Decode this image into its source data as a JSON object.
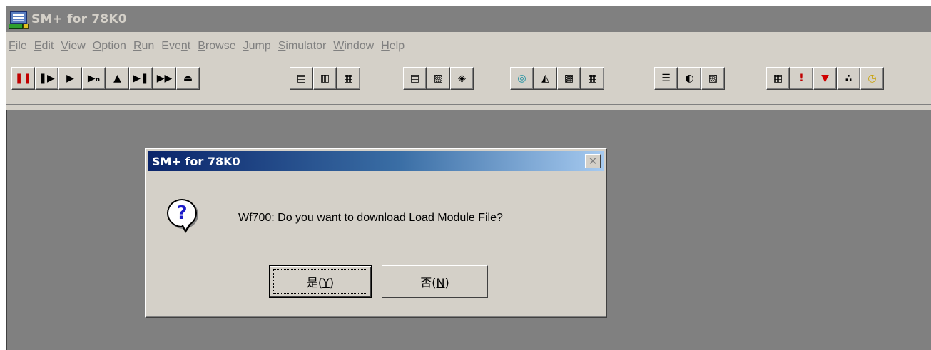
{
  "window": {
    "title": "SM+ for 78K0"
  },
  "menu": [
    {
      "label": "File",
      "mnemonic": "F",
      "rest": "ile"
    },
    {
      "label": "Edit",
      "mnemonic": "E",
      "rest": "dit"
    },
    {
      "label": "View",
      "mnemonic": "V",
      "rest": "iew"
    },
    {
      "label": "Option",
      "mnemonic": "O",
      "rest": "ption"
    },
    {
      "label": "Run",
      "mnemonic": "R",
      "rest": "un"
    },
    {
      "label": "Event",
      "prefix": "Eve",
      "mnemonic": "n",
      "rest": "t"
    },
    {
      "label": "Browse",
      "mnemonic": "B",
      "rest": "rowse"
    },
    {
      "label": "Jump",
      "mnemonic": "J",
      "rest": "ump"
    },
    {
      "label": "Simulator",
      "mnemonic": "S",
      "rest": "imulator"
    },
    {
      "label": "Window",
      "mnemonic": "W",
      "rest": "indow"
    },
    {
      "label": "Help",
      "mnemonic": "H",
      "rest": "elp"
    }
  ],
  "toolbar": {
    "groups": [
      [
        "pause-icon",
        "step-execute-icon",
        "run-icon",
        "next-over-icon",
        "return-icon",
        "step-in-icon",
        "go-icon",
        "eject-icon"
      ],
      [
        "source-text-icon",
        "assemble-icon",
        "memory-icon"
      ],
      [
        "register-icon",
        "sfr-icon",
        "local-variable-icon"
      ],
      [
        "watch-icon",
        "trace-icon",
        "coverage-icon",
        "event-icon"
      ],
      [
        "stack-trace-icon",
        "timing-icon",
        "io-panel-icon"
      ],
      [
        "console-icon",
        "break-icon",
        "stop-icon",
        "footprint-icon",
        "timer-icon"
      ]
    ],
    "glyphs": {
      "pause-icon": "❚❚",
      "step-execute-icon": "❚▶",
      "run-icon": "▶",
      "next-over-icon": "▶ₙ",
      "return-icon": "▲",
      "step-in-icon": "▶❚",
      "go-icon": "▶▶",
      "eject-icon": "⏏",
      "source-text-icon": "▤",
      "assemble-icon": "▥",
      "memory-icon": "▦",
      "register-icon": "▤",
      "sfr-icon": "▧",
      "local-variable-icon": "◈",
      "watch-icon": "◎",
      "trace-icon": "◭",
      "coverage-icon": "▩",
      "event-icon": "▦",
      "stack-trace-icon": "☰",
      "timing-icon": "◐",
      "io-panel-icon": "▧",
      "console-icon": "▦",
      "break-icon": "!",
      "stop-icon": "▼",
      "footprint-icon": "∴",
      "timer-icon": "◷"
    },
    "colors": {
      "pause-icon": "#c00000",
      "stop-icon": "#d00000",
      "break-icon": "#c00000",
      "watch-icon": "#1a8fa0",
      "timer-icon": "#c8a000"
    }
  },
  "dialog": {
    "title": "SM+ for 78K0",
    "icon": "question-icon",
    "message": "Wf700: Do you want to download Load Module File?",
    "yes_button": {
      "text": "是(",
      "mnemonic": "Y",
      "close": ")"
    },
    "no_button": {
      "text": "否(",
      "mnemonic": "N",
      "close": ")"
    },
    "close_glyph": "✕"
  },
  "colors": {
    "face": "#d4d0c8",
    "workspace": "#808080",
    "title_active_start": "#0a246a",
    "title_active_end": "#a6caf0",
    "title_inactive": "#808080"
  }
}
